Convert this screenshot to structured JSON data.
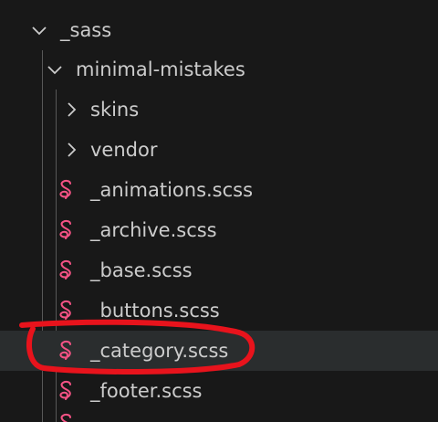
{
  "explorer": {
    "root_folder": {
      "label": "_sass",
      "expanded": true
    },
    "subfolder": {
      "label": "minimal-mistakes",
      "expanded": true
    },
    "children": [
      {
        "type": "folder",
        "label": "skins",
        "expanded": false
      },
      {
        "type": "folder",
        "label": "vendor",
        "expanded": false
      },
      {
        "type": "file",
        "label": "_animations.scss",
        "icon": "sass-icon"
      },
      {
        "type": "file",
        "label": "_archive.scss",
        "icon": "sass-icon"
      },
      {
        "type": "file",
        "label": "_base.scss",
        "icon": "sass-icon"
      },
      {
        "type": "file",
        "label": "_buttons.scss",
        "icon": "sass-icon"
      },
      {
        "type": "file",
        "label": "_category.scss",
        "icon": "sass-icon",
        "selected": true
      },
      {
        "type": "file",
        "label": "_footer.scss",
        "icon": "sass-icon"
      }
    ]
  },
  "colors": {
    "background": "#181818",
    "text": "#cccccc",
    "selected_row": "#2a2d2e",
    "sass_icon": "#f55385",
    "annotation": "#e8131c"
  }
}
